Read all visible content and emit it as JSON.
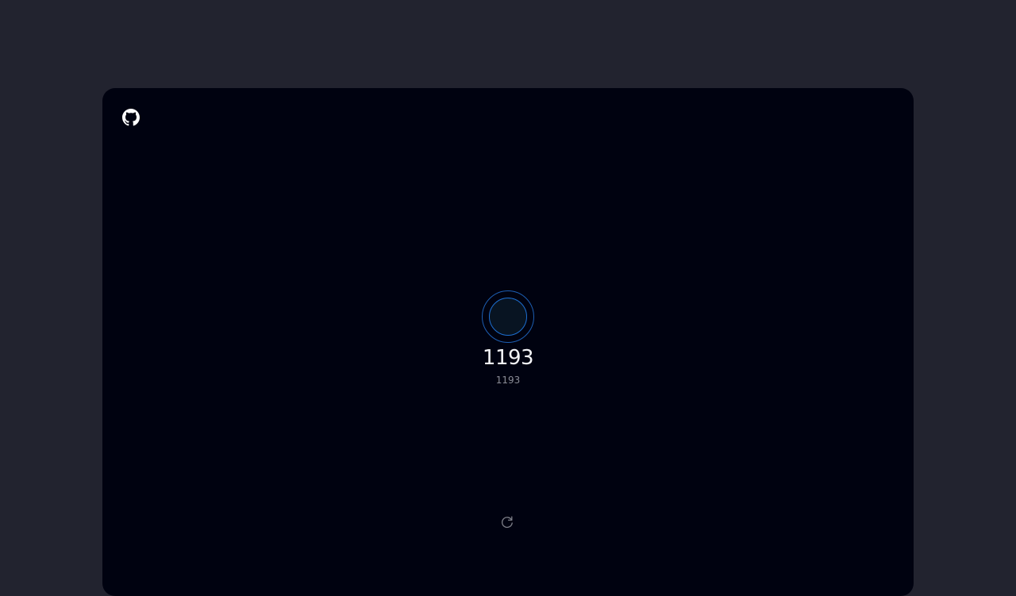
{
  "header": {
    "github_icon": "github-icon"
  },
  "counter": {
    "value": "1193",
    "secondary_value": "1193"
  },
  "controls": {
    "reset_icon": "refresh-icon"
  },
  "colors": {
    "page_background": "#22232f",
    "panel_background": "#000210",
    "ring_accent": "#1d6fd1",
    "counter_text": "#f3f4f7",
    "secondary_text": "#8a8c96"
  }
}
